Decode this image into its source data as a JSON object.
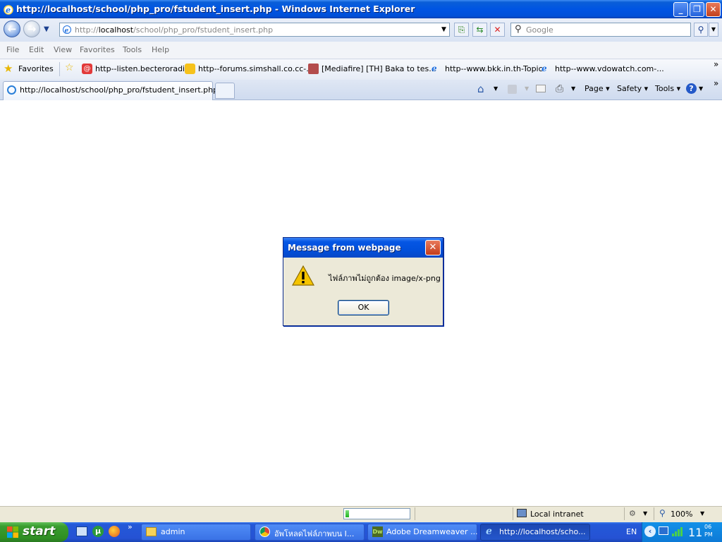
{
  "window": {
    "title": "http://localhost/school/php_pro/fstudent_insert.php - Windows Internet Explorer",
    "controls": [
      "minimize",
      "restore",
      "close"
    ]
  },
  "address_bar": {
    "url_prefix": "http://",
    "url_host": "localhost",
    "url_path": "/school/php_pro/fstudent_insert.php",
    "search_placeholder": "Google"
  },
  "menu": {
    "items": [
      "File",
      "Edit",
      "View",
      "Favorites",
      "Tools",
      "Help"
    ]
  },
  "favorites_bar": {
    "label": "Favorites",
    "links": [
      "http--listen.becteroradio",
      "http--forums.simshall.co.cc-...",
      "[Mediafire] [TH] Baka to tes...",
      "http--www.bkk.in.th-Topic",
      "http--www.vdowatch.com-..."
    ],
    "more": "»"
  },
  "tabs": {
    "active_title": "http://localhost/school/php_pro/fstudent_insert.php"
  },
  "command_bar": {
    "page": "Page",
    "safety": "Safety",
    "tools": "Tools",
    "more": "»"
  },
  "dialog": {
    "title": "Message from webpage",
    "message": "ไฟล์ภาพไม่ถูกต้อง  image/x-png",
    "ok_label": "OK"
  },
  "status_bar": {
    "progress": 0.06,
    "zone": "Local intranet",
    "zoom": "100%"
  },
  "taskbar": {
    "start_label": "start",
    "tasks": [
      "admin",
      "อัพโหลดไฟล์ภาพบน I...",
      "Adobe Dreamweaver ...",
      "http://localhost/scho..."
    ],
    "chevron": "»",
    "language": "EN",
    "clock_hour": "11",
    "clock_minutes": "06",
    "clock_period": "PM"
  },
  "colors": {
    "title_bar": "#0054e3",
    "taskbar": "#2459d8",
    "start_button": "#3a9d2f",
    "dialog_bg": "#ece9d8",
    "warning": "#f5c400"
  }
}
